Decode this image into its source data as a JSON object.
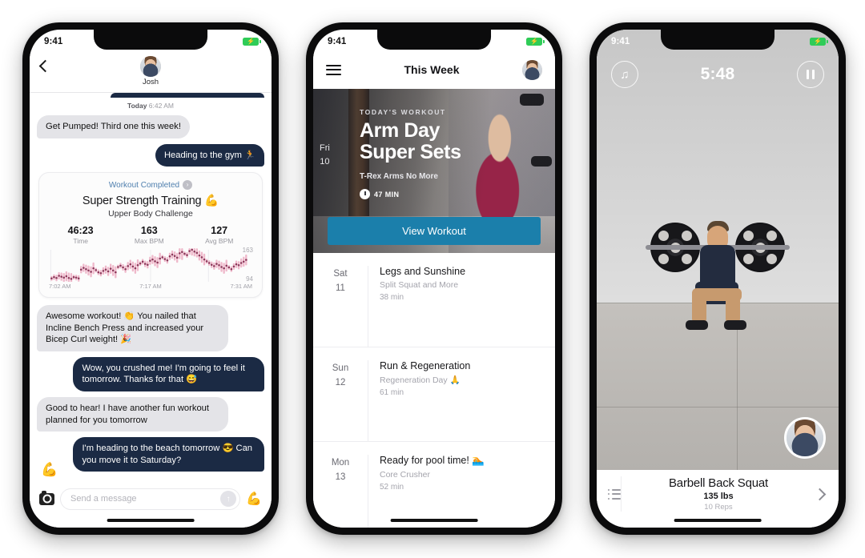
{
  "page": {
    "background": "#ffffff",
    "accent_navy": "#1b2a44",
    "accent_blue": "#1b7fab",
    "link_blue": "#4f7fae"
  },
  "phone_chat": {
    "status": {
      "time": "9:41",
      "battery_icon": "battery-charging-icon"
    },
    "header": {
      "back_icon": "back-chevron-icon",
      "avatar": "contact-avatar",
      "name": "Josh"
    },
    "timestamp": {
      "day": "Today",
      "time": "6:42 AM"
    },
    "messages": [
      {
        "from": "them",
        "text": "Get Pumped! Third one this week!"
      },
      {
        "from": "me",
        "text": "Heading to the gym 🏃"
      }
    ],
    "workout_card": {
      "status_label": "Workout Completed",
      "chevron_icon": "chevron-right-circle-icon",
      "title": "Super Strength Training 💪",
      "subtitle": "Upper Body Challenge",
      "stats": [
        {
          "value": "46:23",
          "label": "Time"
        },
        {
          "value": "163",
          "label": "Max BPM"
        },
        {
          "value": "127",
          "label": "Avg BPM"
        }
      ],
      "chart": {
        "max_label": "163",
        "min_label": "94",
        "x_ticks": [
          "7:02 AM",
          "7:17 AM",
          "7:31 AM"
        ]
      }
    },
    "messages_2": [
      {
        "from": "them",
        "text": "Awesome workout! 👏 You nailed that Incline Bench Press and increased your Bicep Curl weight! 🎉"
      },
      {
        "from": "me",
        "text": "Wow, you crushed me! I'm going to feel it tomorrow. Thanks for that 😅"
      },
      {
        "from": "them",
        "text": "Good to hear! I have another fun workout planned for you tomorrow"
      },
      {
        "from": "me",
        "text": "I'm heading to the beach tomorrow 😎 Can you move it to Saturday?"
      }
    ],
    "reaction_emoji": "💪",
    "composer": {
      "camera_icon": "camera-icon",
      "placeholder": "Send a message",
      "send_icon": "send-arrow-up-icon",
      "flex_emoji": "💪"
    }
  },
  "phone_week": {
    "status": {
      "time": "9:41",
      "battery_icon": "battery-charging-icon"
    },
    "header": {
      "menu_icon": "hamburger-menu-icon",
      "title": "This Week",
      "avatar": "profile-avatar"
    },
    "hero": {
      "date_day": "Fri",
      "date_num": "10",
      "kicker": "TODAY'S WORKOUT",
      "title_line1": "Arm Day",
      "title_line2": "Super Sets",
      "subtitle": "T-Rex Arms No More",
      "duration_icon": "stopwatch-icon",
      "duration": "47 MIN",
      "cta": "View Workout"
    },
    "list": [
      {
        "day": "Sat",
        "num": "11",
        "title": "Legs and Sunshine",
        "subtitle": "Split Squat and More",
        "duration": "38 min"
      },
      {
        "day": "Sun",
        "num": "12",
        "title": "Run & Regeneration",
        "subtitle": "Regeneration Day 🙏",
        "duration": "61 min"
      },
      {
        "day": "Mon",
        "num": "13",
        "title": "Ready for pool time! 🏊",
        "subtitle": "Core Crusher",
        "duration": "52 min"
      }
    ]
  },
  "phone_player": {
    "status": {
      "time": "9:41",
      "battery_icon": "battery-charging-icon"
    },
    "controls": {
      "music_icon": "music-note-icon",
      "timer": "5:48",
      "pause_icon": "pause-icon"
    },
    "coach_avatar": "coach-avatar",
    "bottom": {
      "list_icon": "exercise-list-icon",
      "exercise": "Barbell Back Squat",
      "weight": "135 lbs",
      "reps": "10 Reps",
      "next_icon": "chevron-right-icon"
    }
  },
  "chart_data": {
    "type": "scatter",
    "title": "Heart Rate",
    "xlabel": "",
    "ylabel": "BPM",
    "ylim": [
      94,
      163
    ],
    "x_ticks": [
      "7:02 AM",
      "7:17 AM",
      "7:31 AM"
    ],
    "values": [
      98,
      101,
      99,
      104,
      102,
      100,
      103,
      99,
      97,
      101,
      100,
      98,
      118,
      122,
      119,
      116,
      113,
      121,
      117,
      112,
      110,
      115,
      118,
      114,
      120,
      116,
      112,
      124,
      127,
      123,
      119,
      126,
      130,
      125,
      121,
      128,
      132,
      136,
      131,
      129,
      138,
      141,
      137,
      134,
      143,
      146,
      142,
      139,
      148,
      152,
      149,
      145,
      155,
      158,
      154,
      151,
      160,
      163,
      159,
      156,
      150,
      146,
      141,
      137,
      133,
      129,
      126,
      131,
      128,
      124,
      121,
      127,
      123,
      119,
      125,
      130,
      128,
      133,
      136,
      140
    ]
  }
}
